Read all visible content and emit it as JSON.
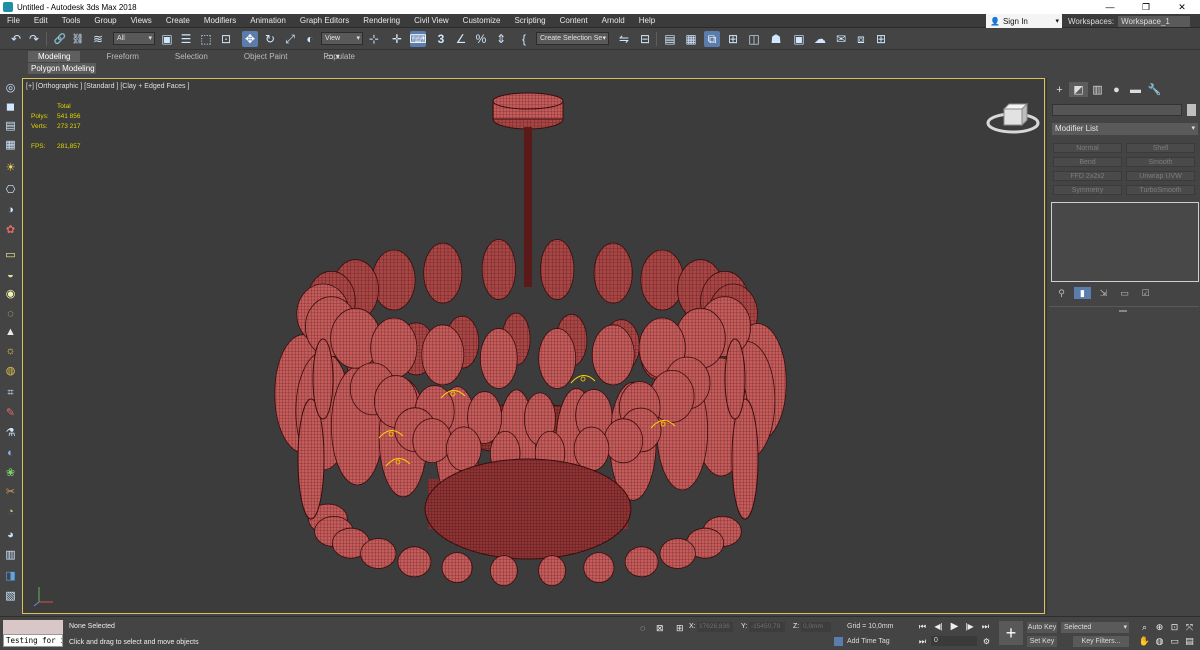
{
  "window": {
    "title": "Untitled - Autodesk 3ds Max 2018",
    "app_icon": "3dsmax-logo-icon",
    "controls": [
      "—",
      "❐",
      "✕"
    ]
  },
  "menu": {
    "items": [
      "File",
      "Edit",
      "Tools",
      "Group",
      "Views",
      "Create",
      "Modifiers",
      "Animation",
      "Graph Editors",
      "Rendering",
      "Civil View",
      "Customize",
      "Scripting",
      "Content",
      "Arnold",
      "Help"
    ],
    "sign_in": "Sign In",
    "workspaces_label": "Workspaces:",
    "workspace_value": "Workspace_1"
  },
  "toolbar": {
    "undo_icon": "↶",
    "redo_icon": "↷",
    "link_icon": "🔗",
    "unlink_icon": "⛓",
    "bind_icon": "≋",
    "filter_value": "All",
    "select_icon": "▣",
    "select_by_name_icon": "☰",
    "rect_region_icon": "⬚",
    "window_cross_icon": "⊡",
    "move_icon": "✥",
    "rotate_icon": "↻",
    "scale_icon": "⤢",
    "placement_icon": "◐",
    "ref_coord_value": "View",
    "pivot_icon": "⊹",
    "manipulate_icon": "✛",
    "keyboard_shortcut_icon": "⌨",
    "snap_label": "3",
    "angle_snap_icon": "∠",
    "percent_snap_label": "%",
    "spinner_snap_icon": "⇕",
    "edit_named_icon": "{",
    "named_selection_value": "Create Selection Se",
    "mirror_icon": "⇋",
    "align_icon": "⊟",
    "layer_icon": "▤",
    "ribbon_toggle_icon": "▦",
    "curve_editor_icon": "⧉",
    "schematic_icon": "⊞",
    "material_editor_icon": "◫",
    "render_setup_icon": "☗",
    "render_frame_icon": "▣",
    "render_icon": "☁",
    "render_cloud_icon": "✉",
    "a360_icon": "⧈"
  },
  "ribbon": {
    "tabs": [
      "Modeling",
      "Freeform",
      "Selection",
      "Object Paint",
      "Populate"
    ],
    "active_tab": "Modeling",
    "panel_label": "Polygon Modeling",
    "extra_icon": "▭ ▾"
  },
  "left_tools": {
    "icons": [
      "◎",
      "◼",
      "▤",
      "▦",
      "☀",
      "⎔",
      "◑",
      "✿",
      "▭",
      "◒",
      "◉",
      "◌",
      "▲",
      "☼",
      "◍",
      "⌗",
      "✎",
      "⚗",
      "◐",
      "❀",
      "✂",
      "◔",
      "◕",
      "▥",
      "◨",
      "▧",
      "◭"
    ]
  },
  "viewport": {
    "label": "[+] [Orthographic ] [Standard ] [Clay + Edged Faces ]",
    "stats": {
      "total_label": "Total",
      "polys_label": "Polys:",
      "polys_value": "541 856",
      "verts_label": "Verts:",
      "verts_value": "273 217",
      "fps_label": "FPS:",
      "fps_value": "281,857"
    },
    "mesh_color": "#c25a5a",
    "wire_color": "#5a1818",
    "selection_color": "#ffd400",
    "border_color": "#d6c35c"
  },
  "command_panel": {
    "tabs": [
      "+",
      "◩",
      "▥",
      "●",
      "▬",
      "🔧"
    ],
    "modifier_list_label": "Modifier List",
    "modifier_buttons": [
      "Normal",
      "Shell",
      "Bend",
      "Smooth",
      "FFD 2x2x2",
      "Unwrap UVW",
      "Symmetry",
      "TurboSmooth"
    ],
    "stack_tools": [
      "⚲",
      "▮",
      "⇲",
      "▭",
      "☑"
    ]
  },
  "status": {
    "selection": "None Selected",
    "prompt": "Click and drag to select and move objects",
    "script_value": "Testing for i",
    "x_label": "X:",
    "x_value": "17626,836",
    "y_label": "Y:",
    "y_value": "-15450,79",
    "z_label": "Z:",
    "z_value": "0,0mm",
    "grid": "Grid = 10,0mm",
    "add_time_tag": "Add Time Tag",
    "playback": [
      "⏮",
      "◀|",
      "▶",
      "|▶",
      "⏭"
    ],
    "frame_value": "0",
    "auto_key": "Auto Key",
    "set_key": "Set Key",
    "selected_value": "Selected",
    "key_filters": "Key Filters...",
    "key_icon": "+",
    "nav_icons": [
      "⌕",
      "⊕",
      "⊡",
      "⤧",
      "✋",
      "◍",
      "▭",
      "▤"
    ],
    "lock_icon": "⊠",
    "isolate_icon": "◌",
    "abs_icon": "⊞",
    "timeconfig_icon": "⚙"
  }
}
